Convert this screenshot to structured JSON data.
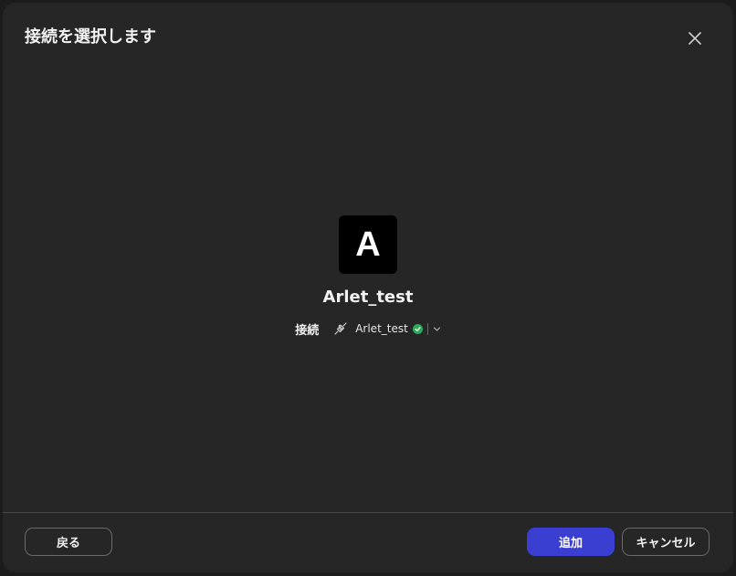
{
  "dialog": {
    "title": "接続を選択します"
  },
  "app": {
    "avatar_letter": "A",
    "name": "Arlet_test"
  },
  "connection": {
    "label": "接続",
    "selected_value": "Arlet_test",
    "status": "connected"
  },
  "footer": {
    "back_label": "戻る",
    "add_label": "追加",
    "cancel_label": "キャンセル"
  },
  "colors": {
    "dialog_bg": "#262626",
    "primary_button": "#3b3fd1",
    "status_ok": "#2ea85a"
  }
}
